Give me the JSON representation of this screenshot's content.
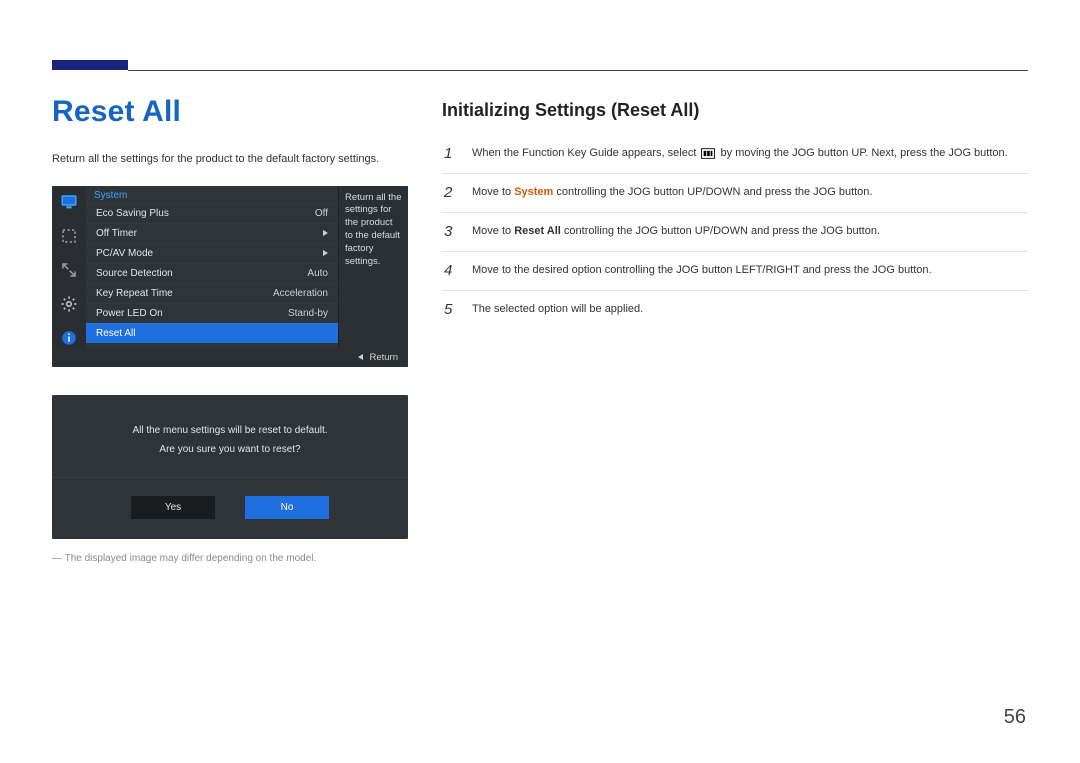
{
  "page": {
    "title": "Reset All",
    "intro": "Return all the settings for the product to the default factory settings.",
    "footnote": "The displayed image may differ depending on the model.",
    "number": "56"
  },
  "osd1": {
    "menu_title": "System",
    "help_text": "Return all the settings for the product to the default factory settings.",
    "return_label": "Return",
    "items": [
      {
        "label": "Eco Saving Plus",
        "value": "Off"
      },
      {
        "label": "Off Timer",
        "value": "▶"
      },
      {
        "label": "PC/AV Mode",
        "value": "▶"
      },
      {
        "label": "Source Detection",
        "value": "Auto"
      },
      {
        "label": "Key Repeat Time",
        "value": "Acceleration"
      },
      {
        "label": "Power LED On",
        "value": "Stand-by"
      },
      {
        "label": "Reset All",
        "value": ""
      }
    ]
  },
  "osd2": {
    "line1": "All the menu settings will be reset to default.",
    "line2": "Are you sure you want to reset?",
    "yes": "Yes",
    "no": "No"
  },
  "right": {
    "heading": "Initializing Settings (Reset All)",
    "steps": {
      "s1a": "When the Function Key Guide appears, select ",
      "s1b": " by moving the JOG button UP. Next, press the JOG button.",
      "s2a": "Move to ",
      "s2_kw": "System",
      "s2b": " controlling the JOG button UP/DOWN and press the JOG button.",
      "s3a": "Move to ",
      "s3_kw": "Reset All",
      "s3b": " controlling the JOG button UP/DOWN and press the JOG button.",
      "s4": "Move to the desired option controlling the JOG button LEFT/RIGHT and press the JOG button.",
      "s5": "The selected option will be applied."
    },
    "nums": {
      "n1": "1",
      "n2": "2",
      "n3": "3",
      "n4": "4",
      "n5": "5"
    }
  }
}
